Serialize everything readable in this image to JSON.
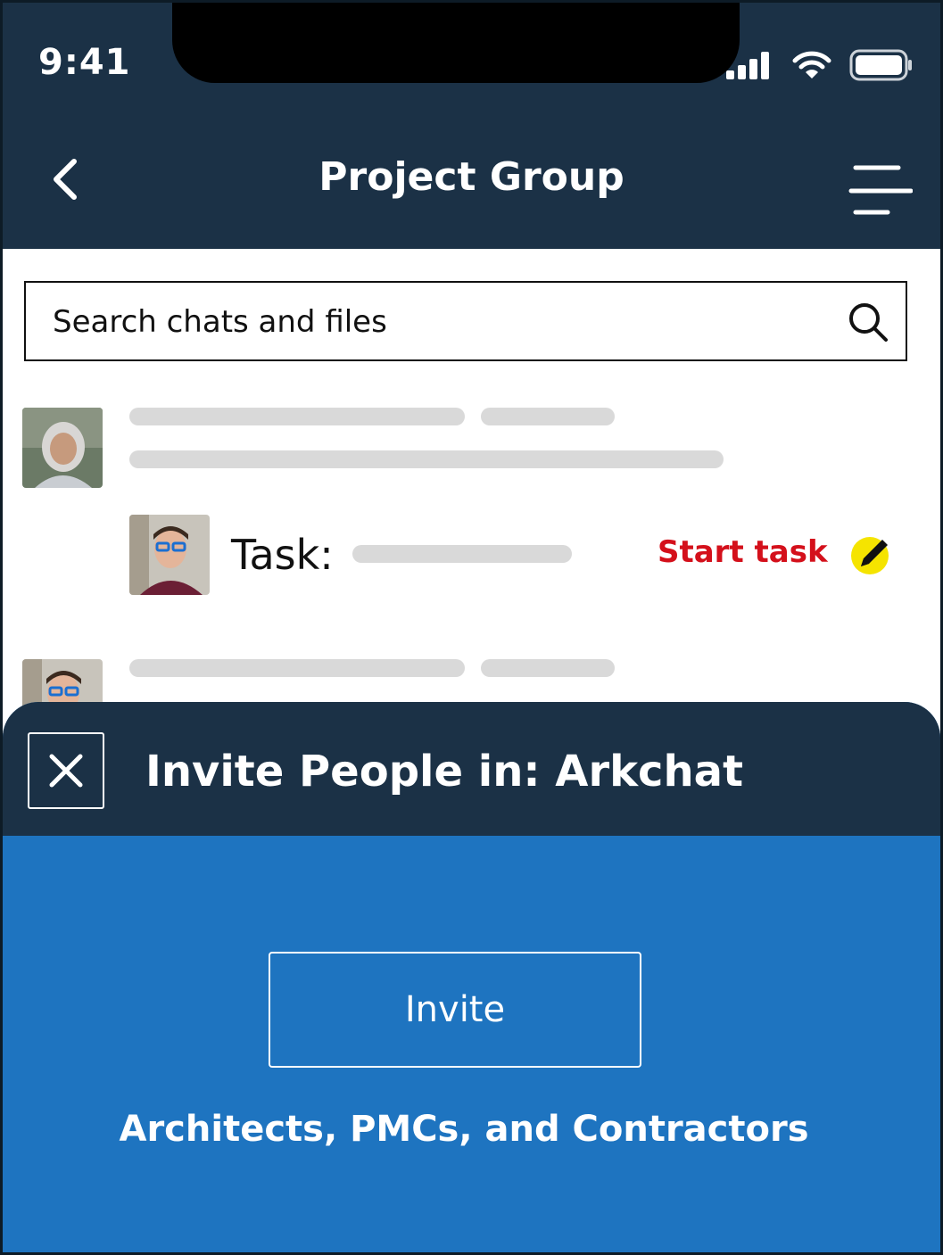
{
  "status_bar": {
    "time": "9:41"
  },
  "header": {
    "title": "Project Group"
  },
  "search": {
    "placeholder": "Search chats and files"
  },
  "chat_items": [
    {
      "type": "message"
    },
    {
      "type": "task",
      "label": "Task:",
      "action": "Start task"
    },
    {
      "type": "message"
    }
  ],
  "invite_sheet": {
    "title": "Invite People in: Arkchat",
    "button_label": "Invite",
    "subtitle": "Architects, PMCs, and Contractors"
  },
  "icons": {
    "back": "chevron-left-icon",
    "menu": "menu-icon",
    "search": "search-icon",
    "edit": "pencil-icon",
    "close": "close-icon"
  },
  "colors": {
    "header_bg": "#1b3146",
    "sheet_bg": "#1e74c0",
    "accent_red": "#d4101b",
    "accent_yellow": "#f5e400",
    "placeholder_bar": "#d9d9d9"
  }
}
